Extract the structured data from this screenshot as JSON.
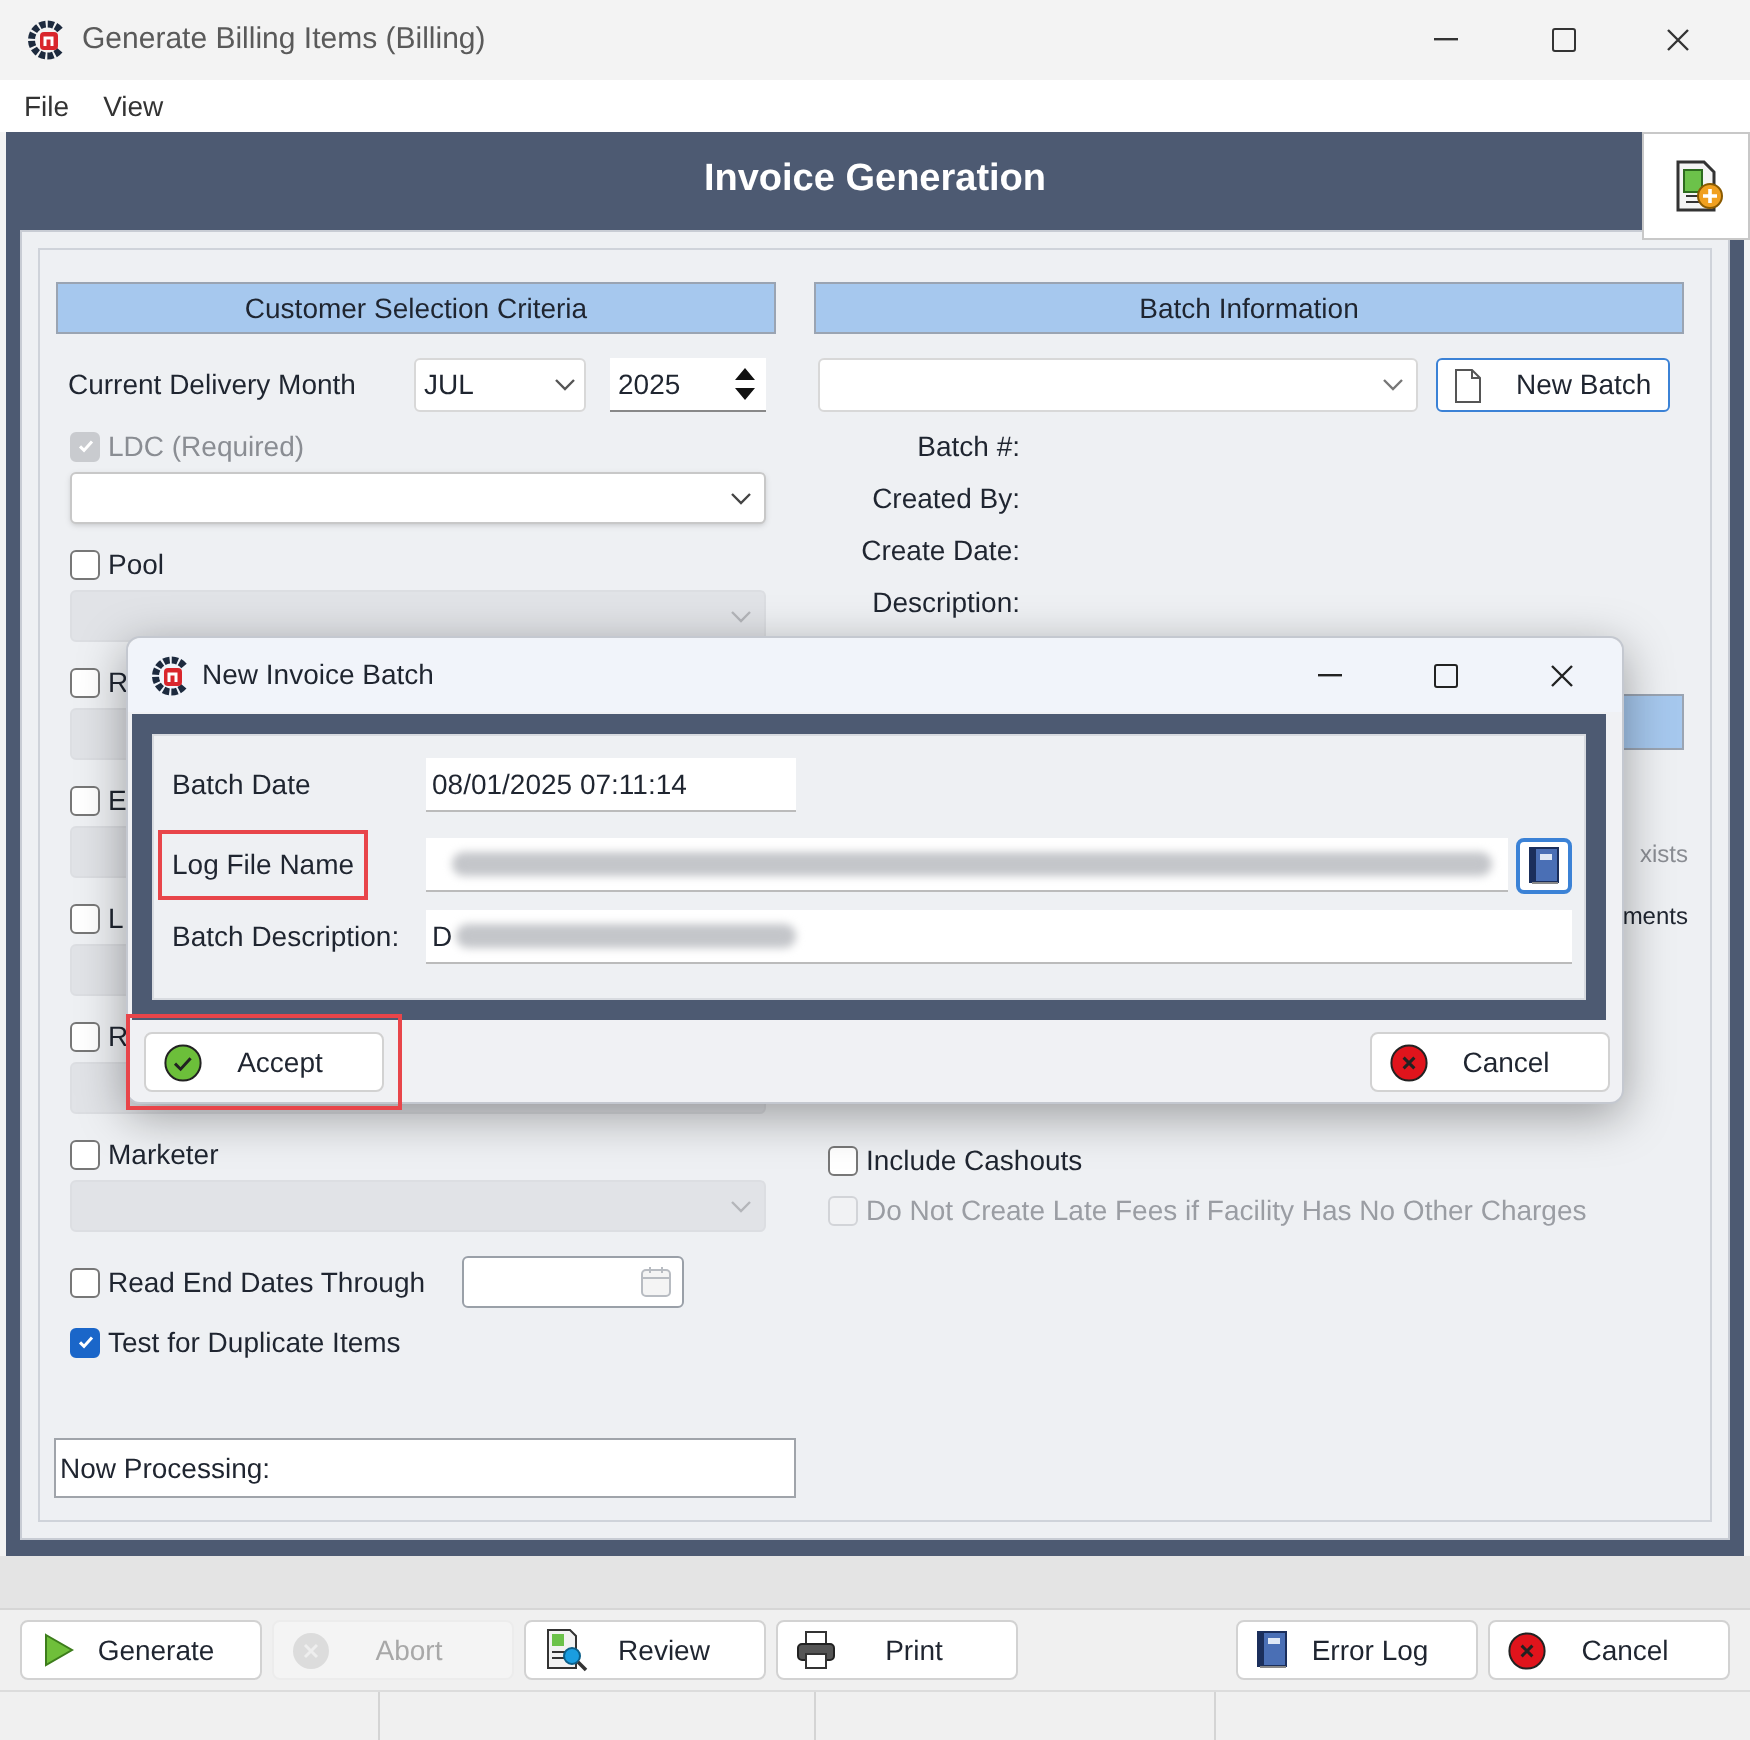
{
  "window": {
    "title": "Generate Billing Items (Billing)"
  },
  "menu": [
    "File",
    "View"
  ],
  "header": {
    "title": "Invoice Generation"
  },
  "customer_selection": {
    "title": "Customer Selection Criteria",
    "delivery_month": {
      "label": "Current Delivery Month",
      "month": "JUL",
      "year": "2025"
    },
    "filters": [
      {
        "label": "LDC (Required)",
        "checked": true,
        "disabled": true,
        "list_disabled": false
      },
      {
        "label": "Pool",
        "checked": false,
        "disabled": false,
        "list_disabled": true
      },
      {
        "label": "R",
        "checked": false,
        "disabled": false,
        "list_disabled": true
      },
      {
        "label": "E",
        "checked": false,
        "disabled": false,
        "list_disabled": true
      },
      {
        "label": "L",
        "checked": false,
        "disabled": false,
        "list_disabled": true
      },
      {
        "label": "R",
        "checked": false,
        "disabled": false,
        "list_disabled": true
      },
      {
        "label": "Marketer",
        "checked": false,
        "disabled": false,
        "list_disabled": true
      }
    ],
    "read_end_dates": {
      "label": "Read End Dates Through",
      "checked": false
    },
    "duplicates": {
      "label": "Test for Duplicate Items",
      "checked": true
    },
    "now_processing": "Now Processing:"
  },
  "batch_information": {
    "title": "Batch Information",
    "new_batch_button": "New Batch",
    "fields": [
      "Batch #:",
      "Created By:",
      "Create Date:",
      "Description:"
    ],
    "fragments": [
      "xists",
      "ments"
    ],
    "options": [
      {
        "label": "Include Cashouts",
        "checked": false,
        "disabled": false
      },
      {
        "label": "Do Not Create Late Fees if Facility Has No Other Charges",
        "checked": false,
        "disabled": true
      }
    ]
  },
  "dialog": {
    "title": "New Invoice Batch",
    "fields": [
      {
        "label": "Batch Date",
        "value": "08/01/2025 07:11:14",
        "kind": "text"
      },
      {
        "label": "Log File Name",
        "kind": "file",
        "blurred": true,
        "highlighted": true
      },
      {
        "label": "Batch Description:",
        "value": "D",
        "kind": "text",
        "blurred": true
      }
    ],
    "buttons": [
      {
        "label": "Accept",
        "kind": "accept",
        "highlighted": true
      },
      {
        "label": "Cancel",
        "kind": "cancel"
      }
    ]
  },
  "toolbar": [
    {
      "label": "Generate",
      "kind": "play",
      "disabled": false
    },
    {
      "label": "Abort",
      "kind": "abort",
      "disabled": true
    },
    {
      "label": "Review",
      "kind": "review",
      "disabled": false
    },
    {
      "label": "Print",
      "kind": "print",
      "disabled": false
    },
    {
      "label": "Error Log",
      "kind": "book",
      "disabled": false
    },
    {
      "label": "Cancel",
      "kind": "cancel",
      "disabled": false
    }
  ]
}
